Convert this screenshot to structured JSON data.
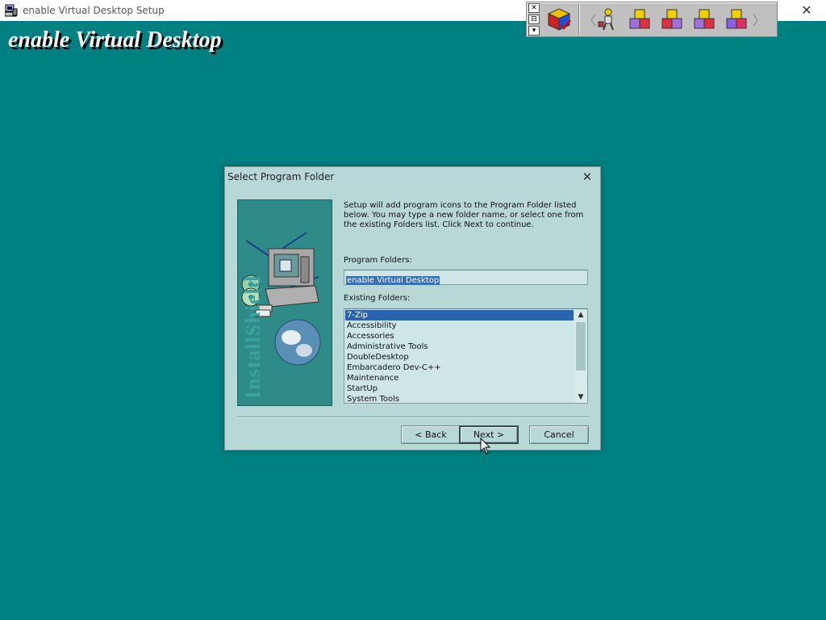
{
  "window": {
    "title": "enable Virtual Desktop Setup",
    "close_glyph": "✕",
    "app_icon": "computer-setup-icon"
  },
  "banner": {
    "title": "enable Virtual Desktop"
  },
  "toolbar": {
    "controls": [
      "✕",
      "⊟",
      "▾"
    ],
    "icons": [
      "rubiks-cube-icon",
      "figure-icon",
      "cubes-purple-icon",
      "cubes-red-icon",
      "cubes-blue-icon",
      "cubes-violet-icon"
    ],
    "left_arrow": "〈",
    "right_arrow": "〉"
  },
  "dialog": {
    "title": "Select Program Folder",
    "close_glyph": "✕",
    "message": "Setup will add program icons to the Program Folder listed below. You may type a new folder name, or select one from the existing Folders list.  Click Next to continue.",
    "program_folders_label": "Program Folders:",
    "program_folder_value": "enable Virtual Desktop",
    "existing_folders_label": "Existing Folders:",
    "existing_folders": [
      "7-Zip",
      "Accessibility",
      "Accessories",
      "Administrative Tools",
      "DoubleDesktop",
      "Embarcadero Dev-C++",
      "Maintenance",
      "StartUp",
      "System Tools"
    ],
    "selected_folder_index": 0,
    "buttons": {
      "back": "< Back",
      "next": "Next >",
      "cancel": "Cancel"
    },
    "side_image_text": "InstallShield"
  },
  "colors": {
    "desktop": "#008080",
    "dialog_bg": "#b8d8d8",
    "selection": "#2a64b0"
  }
}
